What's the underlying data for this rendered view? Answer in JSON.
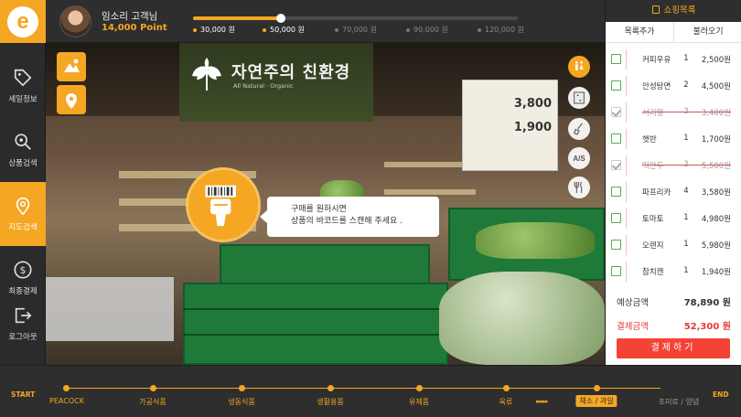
{
  "app": {
    "logo_letter": "e"
  },
  "user": {
    "name": "임소리 고객님",
    "point": "14,000 Point"
  },
  "progress": {
    "level": 0.27,
    "tiers": [
      {
        "label": "30,000 원",
        "reached": true
      },
      {
        "label": "50,000 원",
        "reached": true
      },
      {
        "label": "70,000 원",
        "reached": false
      },
      {
        "label": "90,000 원",
        "reached": false
      },
      {
        "label": "120,000 원",
        "reached": false
      }
    ]
  },
  "sidebar": {
    "items": [
      {
        "label": "세일정보",
        "icon": "tag-icon"
      },
      {
        "label": "상품검색",
        "icon": "search-icon"
      },
      {
        "label": "지도검색",
        "icon": "map-pin-icon"
      },
      {
        "label": "최종결제",
        "icon": "dollar-icon"
      },
      {
        "label": "로그아웃",
        "icon": "logout-icon"
      }
    ],
    "active_index": 2
  },
  "scene": {
    "store_sign_title": "자연주의 친환경",
    "store_sign_sub": "All Natural · Organic",
    "prices": [
      "3,800",
      "1,900"
    ],
    "scan_hint_line1": "구매를 원하시면",
    "scan_hint_line2": "상품의 바코드를 스캔해 주세요 .",
    "side_buttons": [
      "restroom-icon",
      "elevator-icon",
      "broom-icon",
      "A/S",
      "restaurant-icon"
    ]
  },
  "shopping": {
    "title": "쇼핑목록",
    "tab_add": "목록추가",
    "tab_load": "불러오기",
    "items": [
      {
        "name": "커피우유",
        "qty": "1",
        "price": "2,500원",
        "done": false
      },
      {
        "name": "안성탕면",
        "qty": "2",
        "price": "4,500원",
        "done": false
      },
      {
        "name": "서리얼",
        "qty": "3",
        "price": "3,400원",
        "done": true
      },
      {
        "name": "햇반",
        "qty": "1",
        "price": "1,700원",
        "done": false
      },
      {
        "name": "떡만두",
        "qty": "3",
        "price": "5,500원",
        "done": true
      },
      {
        "name": "파프리카",
        "qty": "4",
        "price": "3,580원",
        "done": false
      },
      {
        "name": "토마토",
        "qty": "1",
        "price": "4,980원",
        "done": false
      },
      {
        "name": "오렌지",
        "qty": "1",
        "price": "5,980원",
        "done": false
      },
      {
        "name": "참치캔",
        "qty": "1",
        "price": "1,940원",
        "done": false
      }
    ],
    "expected_label": "예상금액",
    "expected_value": "78,890 원",
    "paid_label": "결제금액",
    "paid_value": "52,300 원",
    "pay_button": "결제하기"
  },
  "route": {
    "start": "START",
    "end": "END",
    "stops": [
      {
        "label": "PEACOCK",
        "state": "passed"
      },
      {
        "label": "가공식품",
        "state": "passed"
      },
      {
        "label": "냉동식품",
        "state": "passed"
      },
      {
        "label": "생활용품",
        "state": "passed"
      },
      {
        "label": "유제품",
        "state": "passed"
      },
      {
        "label": "육류",
        "state": "passed"
      },
      {
        "label": "채소 / 과일",
        "state": "current"
      },
      {
        "label": "조미료 / 양념",
        "state": "upcoming"
      }
    ]
  },
  "colors": {
    "accent": "#f5a623",
    "danger": "#f44336",
    "check": "#4caf50"
  }
}
